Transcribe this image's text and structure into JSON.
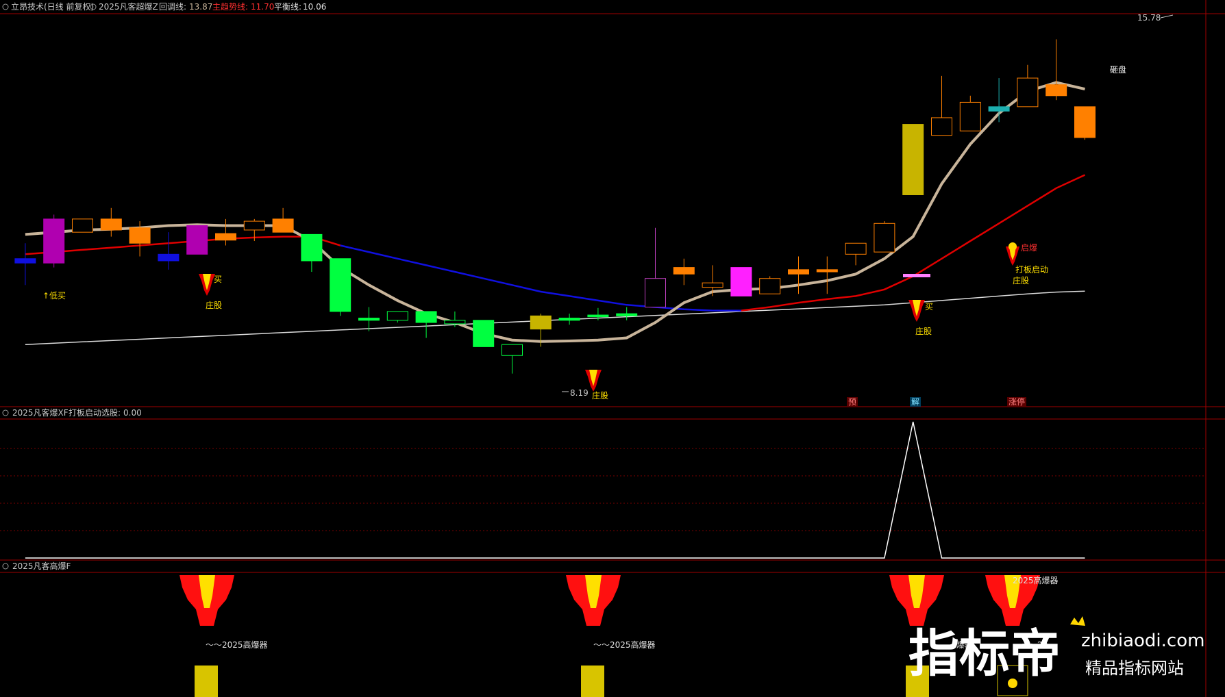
{
  "main_header": {
    "title": "立昂技术(日线 前复权)",
    "indicator": "2025凡客超爆Z",
    "pullback_label": "回调线:",
    "pullback_value": "13.87",
    "trend_label": "主趋势线:",
    "trend_value": "11.70",
    "balance_label": "平衡线:",
    "balance_value": "10.06"
  },
  "sub1_header": {
    "indicator": "2025凡客爆XF",
    "label": "打板启动选股:",
    "value": "0.00"
  },
  "sub2_header": {
    "indicator": "2025凡客高爆F"
  },
  "annotations": {
    "low_buy": "↑低买",
    "buy": "买",
    "buy2": "买",
    "zhuang": "庄股",
    "zhuang2": "庄股",
    "zhuang3": "庄股",
    "zhuang4": "庄股",
    "high_label": "15.78",
    "low_label": "8.19",
    "zapan": "砸盘",
    "baozhang": "启爆",
    "daban": "打板启动",
    "signal_yu": "预",
    "signal_jie": "解",
    "signal_zhangting": "涨停"
  },
  "sub2_labels": {
    "gaobao1": "～～2025高爆器",
    "gaobao2": "～～2025高爆器",
    "gaobao3": "2025高爆器",
    "gaobao4": "爆器",
    "gaobao5": "～～20"
  },
  "watermark": {
    "main": "指标帝",
    "domain": "zhibiaodi.com",
    "sub": "精品指标网站"
  },
  "colors": {
    "up": "#ff8000",
    "down": "#00ff40",
    "pullback": "#c8b49a",
    "trend": "#e00000",
    "trend_down": "#1010e0",
    "balance": "#dcdcdc",
    "panel_border": "#a00000"
  },
  "chart_data": {
    "type": "candlestick",
    "ylim": [
      7.5,
      16.3
    ],
    "candles": [
      {
        "o": 10.7,
        "h": 11.15,
        "l": 10.2,
        "c": 10.8,
        "fill": "#1010e0"
      },
      {
        "o": 10.7,
        "h": 11.8,
        "l": 10.6,
        "c": 11.7,
        "fill": "#b000b0"
      },
      {
        "o": 11.4,
        "h": 11.7,
        "l": 11.4,
        "c": 11.7,
        "fill": "hollow"
      },
      {
        "o": 11.45,
        "h": 11.95,
        "l": 11.3,
        "c": 11.7,
        "fill": "#ff8000"
      },
      {
        "o": 11.5,
        "h": 11.65,
        "l": 10.85,
        "c": 11.15,
        "fill": "#ff8000"
      },
      {
        "o": 10.9,
        "h": 11.4,
        "l": 10.55,
        "c": 10.75,
        "fill": "#1010e0"
      },
      {
        "o": 10.9,
        "h": 11.55,
        "l": 10.9,
        "c": 11.55,
        "fill": "#b000b0"
      },
      {
        "o": 11.22,
        "h": 11.7,
        "l": 11.1,
        "c": 11.37,
        "fill": "#ff8000"
      },
      {
        "o": 11.45,
        "h": 11.7,
        "l": 11.2,
        "c": 11.65,
        "fill": "hollow"
      },
      {
        "o": 11.4,
        "h": 11.95,
        "l": 11.4,
        "c": 11.7,
        "fill": "#ff8000"
      },
      {
        "o": 11.35,
        "h": 11.35,
        "l": 10.5,
        "c": 10.75,
        "fill": "#00ff40"
      },
      {
        "o": 10.8,
        "h": 10.8,
        "l": 9.5,
        "c": 9.6,
        "fill": "#00ff40"
      },
      {
        "o": 9.45,
        "h": 9.7,
        "l": 9.15,
        "c": 9.4,
        "fill": "#00ff40"
      },
      {
        "o": 9.6,
        "h": 9.6,
        "l": 9.35,
        "c": 9.4,
        "fill": "hollow"
      },
      {
        "o": 9.6,
        "h": 9.6,
        "l": 9.0,
        "c": 9.35,
        "fill": "#00ff40"
      },
      {
        "o": 9.4,
        "h": 9.6,
        "l": 9.25,
        "c": 9.32,
        "fill": "hollow"
      },
      {
        "o": 9.4,
        "h": 9.4,
        "l": 8.8,
        "c": 8.8,
        "fill": "#00ff40"
      },
      {
        "o": 8.85,
        "h": 8.85,
        "l": 8.19,
        "c": 8.6,
        "fill": "hollow"
      },
      {
        "o": 9.2,
        "h": 9.55,
        "l": 8.8,
        "c": 9.5,
        "fill": "#c8b400"
      },
      {
        "o": 9.45,
        "h": 9.55,
        "l": 9.3,
        "c": 9.4,
        "fill": "#00ff40"
      },
      {
        "o": 9.52,
        "h": 9.68,
        "l": 9.4,
        "c": 9.48,
        "fill": "#00ff40"
      },
      {
        "o": 9.55,
        "h": 9.7,
        "l": 9.4,
        "c": 9.5,
        "fill": "#00ff40"
      },
      {
        "o": 9.7,
        "h": 11.5,
        "l": 9.7,
        "c": 10.35,
        "fill": "hollow-purple"
      },
      {
        "o": 10.45,
        "h": 10.8,
        "l": 10.2,
        "c": 10.6,
        "fill": "#ff8000"
      },
      {
        "o": 10.15,
        "h": 10.65,
        "l": 9.95,
        "c": 10.25,
        "fill": "hollow"
      },
      {
        "o": 9.95,
        "h": 10.6,
        "l": 9.95,
        "c": 10.6,
        "fill": "#ff20ff"
      },
      {
        "o": 10.0,
        "h": 10.4,
        "l": 10.0,
        "c": 10.35,
        "fill": "hollow"
      },
      {
        "o": 10.45,
        "h": 10.85,
        "l": 10.0,
        "c": 10.55,
        "fill": "#ff8000"
      },
      {
        "o": 10.55,
        "h": 10.85,
        "l": 10.0,
        "c": 10.5,
        "fill": "#ff8000"
      },
      {
        "o": 10.9,
        "h": 10.9,
        "l": 10.65,
        "c": 11.15,
        "fill": "hollow"
      },
      {
        "o": 10.95,
        "h": 11.65,
        "l": 10.95,
        "c": 11.6,
        "fill": "hollow"
      },
      {
        "o": 12.25,
        "h": 13.85,
        "l": 12.25,
        "c": 13.85,
        "fill": "#c8b400"
      },
      {
        "o": 13.6,
        "h": 14.95,
        "l": 13.6,
        "c": 14.0,
        "fill": "hollow"
      },
      {
        "o": 13.7,
        "h": 14.5,
        "l": 13.7,
        "c": 14.35,
        "fill": "hollow"
      },
      {
        "o": 14.15,
        "h": 14.9,
        "l": 13.9,
        "c": 14.25,
        "fill": "#1cb0b0"
      },
      {
        "o": 14.25,
        "h": 15.2,
        "l": 14.25,
        "c": 14.9,
        "fill": "hollow"
      },
      {
        "o": 14.75,
        "h": 15.78,
        "l": 14.4,
        "c": 14.5,
        "fill": "#ff8000"
      },
      {
        "o": 14.25,
        "h": 14.25,
        "l": 13.5,
        "c": 13.55,
        "fill": "#ff8000"
      }
    ],
    "pullback_line": [
      11.35,
      11.4,
      11.45,
      11.47,
      11.5,
      11.55,
      11.57,
      11.55,
      11.55,
      11.55,
      11.2,
      10.6,
      10.2,
      9.85,
      9.55,
      9.35,
      9.1,
      8.95,
      8.92,
      8.93,
      8.95,
      9.0,
      9.35,
      9.8,
      10.05,
      10.1,
      10.12,
      10.2,
      10.3,
      10.45,
      10.8,
      11.3,
      12.5,
      13.4,
      14.1,
      14.6,
      14.8,
      14.65
    ],
    "trend_line": [
      10.9,
      10.95,
      11.0,
      11.05,
      11.1,
      11.15,
      11.2,
      11.25,
      11.28,
      11.3,
      11.3,
      11.1,
      10.95,
      10.8,
      10.65,
      10.5,
      10.35,
      10.2,
      10.05,
      9.95,
      9.85,
      9.75,
      9.7,
      9.65,
      9.62,
      9.62,
      9.7,
      9.8,
      9.88,
      9.95,
      10.1,
      10.4,
      10.8,
      11.2,
      11.6,
      12.0,
      12.4,
      12.7
    ],
    "balance_line": [
      8.85,
      8.88,
      8.91,
      8.94,
      8.97,
      9.0,
      9.03,
      9.06,
      9.09,
      9.12,
      9.15,
      9.18,
      9.21,
      9.24,
      9.27,
      9.3,
      9.33,
      9.36,
      9.39,
      9.42,
      9.45,
      9.48,
      9.51,
      9.54,
      9.57,
      9.6,
      9.63,
      9.66,
      9.69,
      9.72,
      9.75,
      9.8,
      9.85,
      9.9,
      9.95,
      10.0,
      10.04,
      10.06
    ],
    "sub1_signal": {
      "name": "打板启动选股",
      "ylim": [
        0,
        1
      ],
      "values": [
        0,
        0,
        0,
        0,
        0,
        0,
        0,
        0,
        0,
        0,
        0,
        0,
        0,
        0,
        0,
        0,
        0,
        0,
        0,
        0,
        0,
        0,
        0,
        0,
        0,
        0,
        0,
        0,
        0,
        0,
        0,
        1,
        0,
        0,
        0,
        0,
        0,
        0
      ]
    }
  }
}
